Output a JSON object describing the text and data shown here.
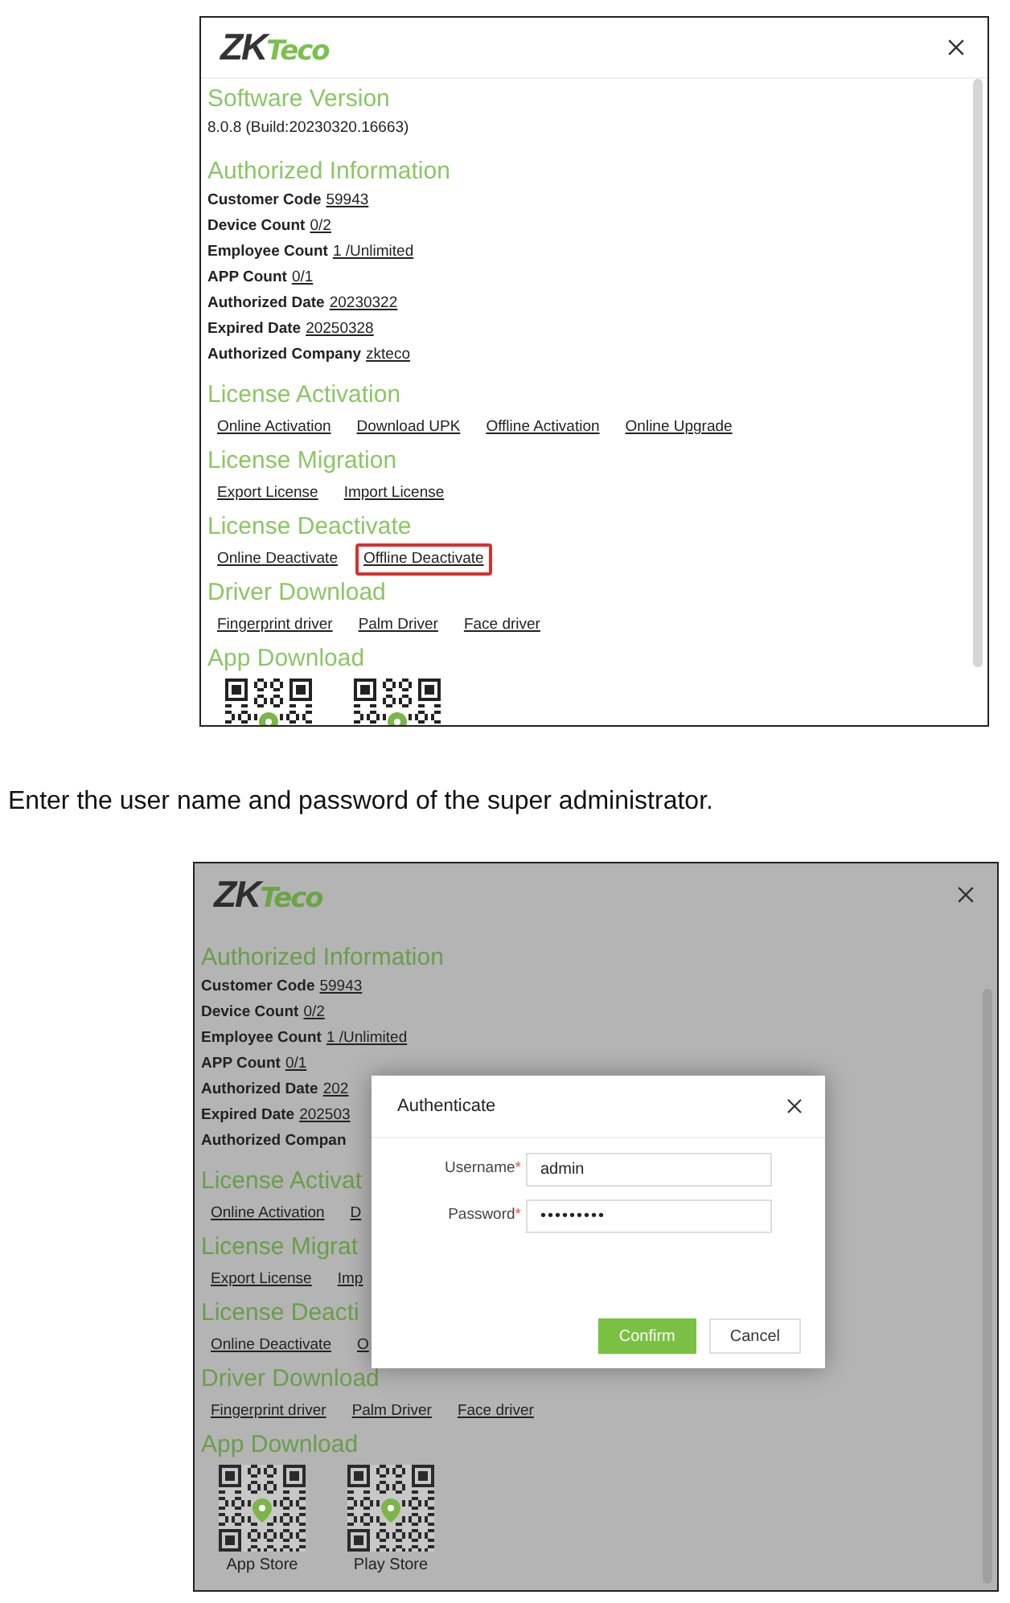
{
  "screenshots": [
    {
      "dimmed": false,
      "logo": {
        "mark": "ZK",
        "word": "Teco"
      },
      "sections": [
        {
          "kind": "text",
          "title": "Software Version",
          "text": "8.0.8 (Build:20230320.16663)"
        },
        {
          "kind": "fields",
          "title": "Authorized Information",
          "fields": [
            {
              "label": "Customer Code",
              "value": "59943"
            },
            {
              "label": "Device Count",
              "value": "0/2"
            },
            {
              "label": "Employee Count",
              "value": "1 /Unlimited"
            },
            {
              "label": "APP Count",
              "value": "0/1"
            },
            {
              "label": "Authorized Date",
              "value": "20230322"
            },
            {
              "label": "Expired Date",
              "value": "20250328"
            },
            {
              "label": "Authorized Company",
              "value": "zkteco"
            }
          ]
        },
        {
          "kind": "links",
          "title": "License Activation",
          "links": [
            {
              "label": "Online Activation",
              "highlighted": false
            },
            {
              "label": "Download UPK",
              "highlighted": false
            },
            {
              "label": "Offline Activation",
              "highlighted": false
            },
            {
              "label": "Online Upgrade",
              "highlighted": false
            }
          ]
        },
        {
          "kind": "links",
          "title": "License Migration",
          "links": [
            {
              "label": "Export License",
              "highlighted": false
            },
            {
              "label": "Import License",
              "highlighted": false
            }
          ]
        },
        {
          "kind": "links",
          "title": "License Deactivate",
          "links": [
            {
              "label": "Online Deactivate",
              "highlighted": false
            },
            {
              "label": "Offline Deactivate",
              "highlighted": true
            }
          ]
        },
        {
          "kind": "links",
          "title": "Driver Download",
          "links": [
            {
              "label": "Fingerprint driver",
              "highlighted": false
            },
            {
              "label": "Palm Driver",
              "highlighted": false
            },
            {
              "label": "Face driver",
              "highlighted": false
            }
          ]
        },
        {
          "kind": "qr",
          "title": "App Download",
          "qr_codes": [
            {
              "kind": "qr"
            },
            {
              "kind": "qr"
            }
          ]
        }
      ]
    },
    {
      "dimmed": true,
      "logo": {
        "mark": "ZK",
        "word": "Teco"
      },
      "sections": [
        {
          "kind": "fields",
          "title": "Authorized Information",
          "fields": [
            {
              "label": "Customer Code",
              "value": "59943"
            },
            {
              "label": "Device Count",
              "value": "0/2"
            },
            {
              "label": "Employee Count",
              "value": "1 /Unlimited"
            },
            {
              "label": "APP Count",
              "value": "0/1"
            },
            {
              "label": "Authorized Date",
              "value": "202"
            },
            {
              "label": "Expired Date",
              "value": "202503"
            },
            {
              "label": "Authorized Compan"
            }
          ]
        },
        {
          "kind": "links",
          "title": "License Activat",
          "links": [
            {
              "label": "Online Activation",
              "highlighted": false
            },
            {
              "label": "D",
              "highlighted": false
            }
          ]
        },
        {
          "kind": "links",
          "title": "License Migrat",
          "links": [
            {
              "label": "Export License",
              "highlighted": false
            },
            {
              "label": "Imp",
              "highlighted": false
            }
          ]
        },
        {
          "kind": "links",
          "title": "License Deacti",
          "links": [
            {
              "label": "Online Deactivate",
              "highlighted": false
            },
            {
              "label": "O",
              "highlighted": false
            }
          ]
        },
        {
          "kind": "links",
          "title": "Driver Download",
          "links": [
            {
              "label": "Fingerprint driver",
              "highlighted": false
            },
            {
              "label": "Palm Driver",
              "highlighted": false
            },
            {
              "label": "Face driver",
              "highlighted": false
            }
          ]
        },
        {
          "kind": "qr",
          "title": "App Download",
          "qr_codes": [
            {
              "kind": "qr",
              "caption": "App Store"
            },
            {
              "kind": "qr",
              "caption": "Play Store"
            }
          ]
        }
      ],
      "dialog": {
        "title": "Authenticate",
        "fields": [
          {
            "label": "Username",
            "required_mark": "*",
            "value": "admin",
            "kind": "text"
          },
          {
            "label": "Password",
            "required_mark": "*",
            "value": "•••••••••",
            "kind": "password"
          }
        ],
        "buttons": [
          {
            "label": "Confirm",
            "kind": "primary"
          },
          {
            "label": "Cancel",
            "kind": "secondary"
          }
        ]
      }
    }
  ],
  "caption": "Enter the user name and password of the super administrator."
}
